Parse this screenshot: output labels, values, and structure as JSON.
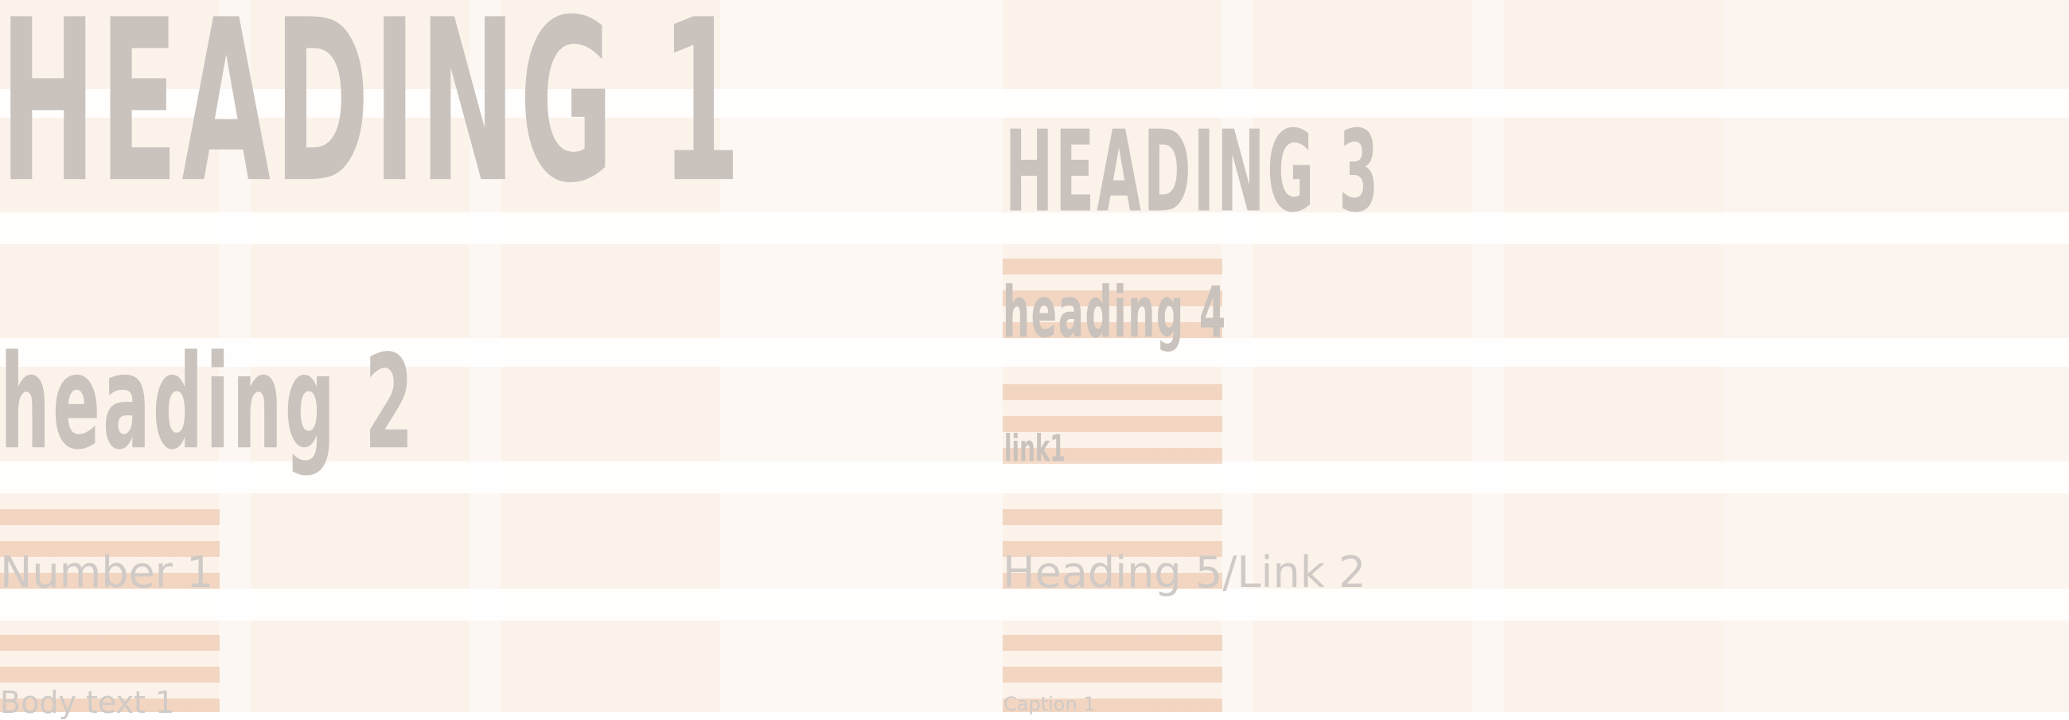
{
  "styles": {
    "heading1": "HEADING 1",
    "heading2": "heading 2",
    "heading3": "HEADING 3",
    "heading4": "heading 4",
    "link1": "link1",
    "number1": "Number 1",
    "heading5_link2": "Heading 5/Link 2",
    "body_text1": "Body text 1",
    "caption1": "Caption 1"
  },
  "colors": {
    "grid_column": "#f5e1cd",
    "grid_row_gap": "#ffffff",
    "stripe": "#ebbea0",
    "text": "#c9c2bd"
  }
}
